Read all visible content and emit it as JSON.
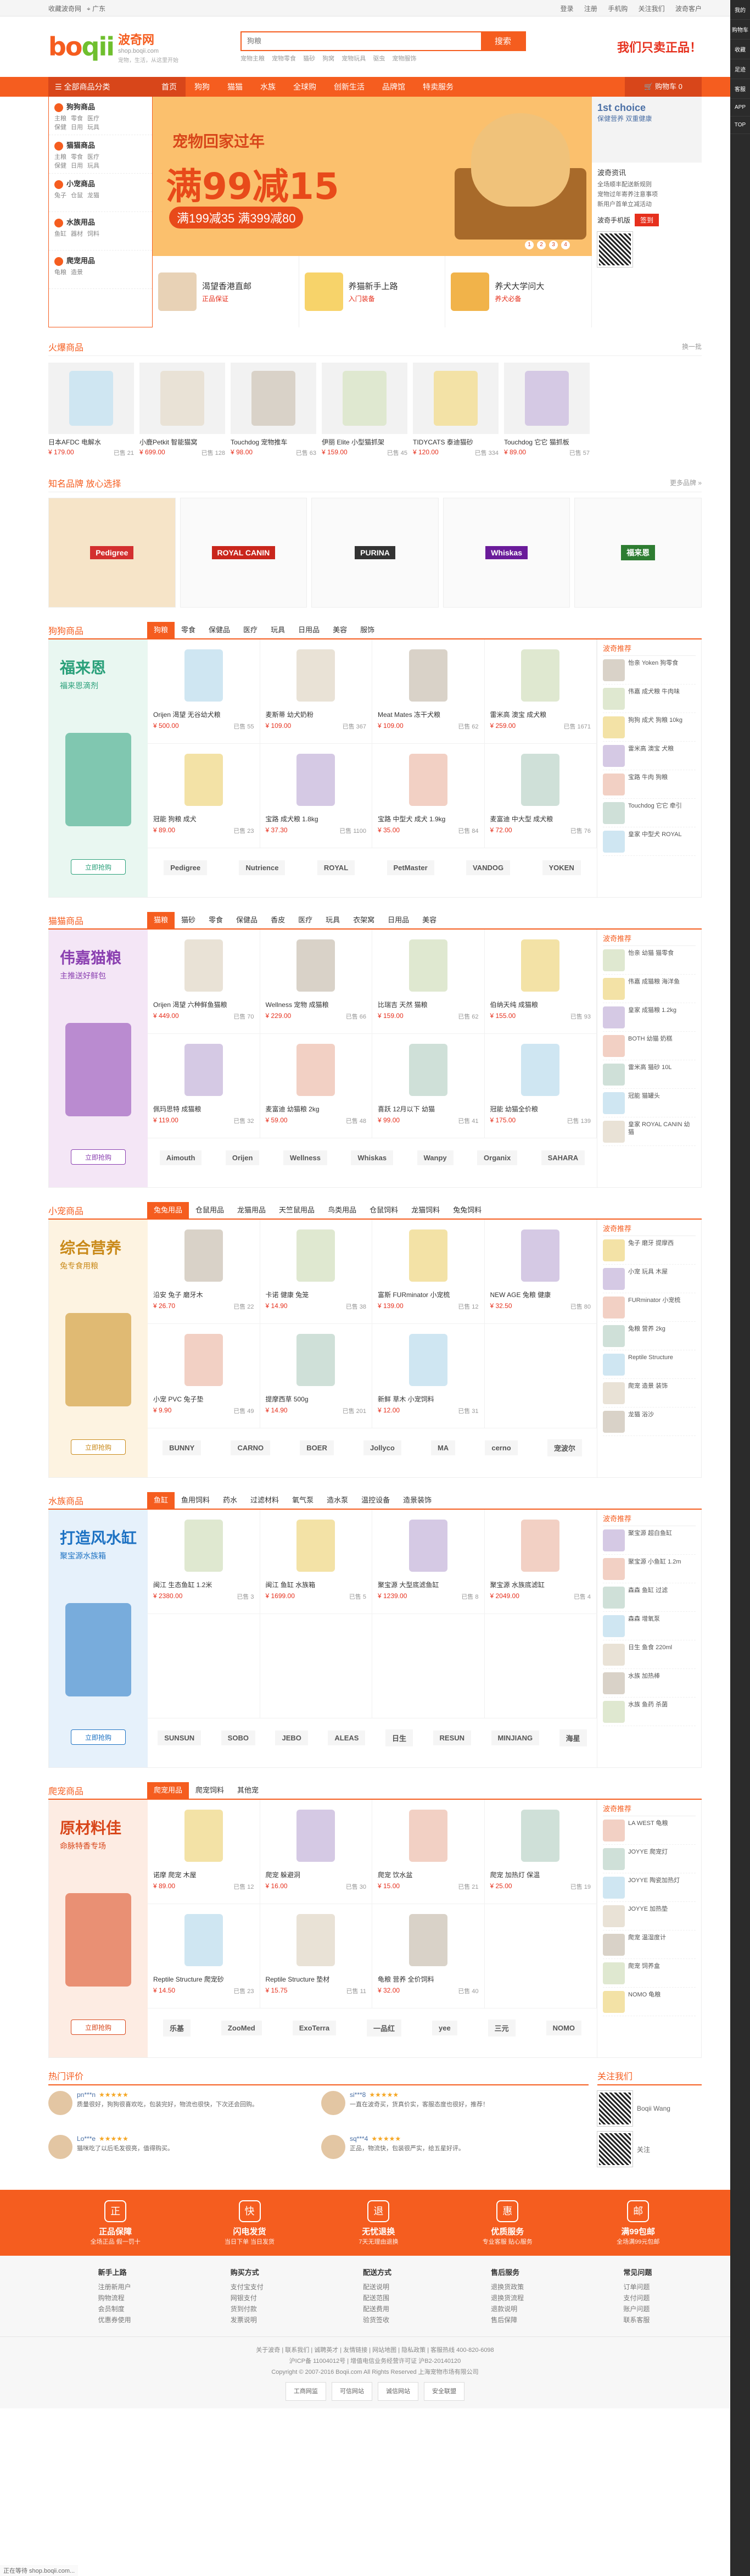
{
  "topbar": {
    "left": [
      "收藏波奇网",
      "广东"
    ],
    "links": [
      "登录",
      "注册",
      "手机购",
      "关注我们",
      "波奇客户"
    ]
  },
  "header": {
    "logo_text": "boqii",
    "logo_cn": "波奇网",
    "logo_en": "shop.boqii.com",
    "slogan": "宠物，生活，从这里开始",
    "search_placeholder": "狗粮",
    "search_button": "搜索",
    "hotwords": [
      "宠物主粮",
      "宠物零食",
      "猫砂",
      "狗窝",
      "宠物玩具",
      "驱虫",
      "宠物服饰"
    ],
    "right_text": "我们只卖正品！"
  },
  "nav": {
    "category_label": "全部商品分类",
    "items": [
      "首页",
      "狗狗",
      "猫猫",
      "水族",
      "全球购",
      "创新生活",
      "品牌馆",
      "特卖服务"
    ],
    "cart_label": "购物车",
    "cart_count": "0"
  },
  "sidebar": [
    {
      "title": "狗狗商品",
      "subs": [
        "主粮",
        "零食",
        "医疗",
        "保健",
        "日用",
        "玩具"
      ]
    },
    {
      "title": "猫猫商品",
      "subs": [
        "主粮",
        "零食",
        "医疗",
        "保健",
        "日用",
        "玩具"
      ]
    },
    {
      "title": "小宠商品",
      "subs": [
        "兔子",
        "仓鼠",
        "龙猫"
      ]
    },
    {
      "title": "水族用品",
      "subs": [
        "鱼缸",
        "器材",
        "饲料"
      ]
    },
    {
      "title": "爬宠用品",
      "subs": [
        "龟粮",
        "造景"
      ]
    }
  ],
  "banner": {
    "title": "宠物回家过年",
    "big": "满99减15",
    "sub": "满199减35 满399减80",
    "dots": [
      "1",
      "2",
      "3",
      "4"
    ]
  },
  "hero_right": {
    "ad_title": "1st choice",
    "ad_sub": "保健营养 双重健康",
    "news_head": "波奇资讯",
    "news": [
      "全场顺丰配送新规则",
      "宠物过年寄养注意事项",
      "新用户首单立减活动"
    ],
    "signin": "签到",
    "app_text": "波奇手机版"
  },
  "promos": [
    {
      "title": "渴望香港直邮",
      "sub": "正品保证"
    },
    {
      "title": "养猫新手上路",
      "sub": "入门装备"
    },
    {
      "title": "养犬大学问大",
      "sub": "养犬必备"
    }
  ],
  "hot": {
    "title": "火爆商品",
    "more": "换一批",
    "items": [
      {
        "name": "日本AFDC 电解水",
        "price": "¥ 179.00",
        "sold": "已售 21"
      },
      {
        "name": "小鹿Petkit 智能猫窝",
        "price": "¥ 699.00",
        "sold": "已售 128"
      },
      {
        "name": "Touchdog 宠物推车",
        "price": "¥ 98.00",
        "sold": "已售 63"
      },
      {
        "name": "伊丽 Elite 小型猫抓架",
        "price": "¥ 159.00",
        "sold": "已售 45"
      },
      {
        "name": "TIDYCATS 泰迪猫砂",
        "price": "¥ 120.00",
        "sold": "已售 334"
      },
      {
        "name": "Touchdog 它它 猫抓板",
        "price": "¥ 89.00",
        "sold": "已售 57"
      }
    ]
  },
  "brands": {
    "title": "知名品牌 放心选择",
    "more": "更多品牌 »",
    "logos": [
      "Pedigree",
      "ROYAL CANIN",
      "PURINA",
      "Whiskas",
      "福来恩"
    ]
  },
  "floors": [
    {
      "title": "狗狗商品",
      "tabs": [
        "狗粮",
        "零食",
        "保健品",
        "医疗",
        "玩具",
        "日用品",
        "美容",
        "服饰"
      ],
      "ad_title": "福来恩",
      "ad_sub": "福来恩滴剂",
      "ad_btn": "立即抢购",
      "ad_color": "#2aa07a",
      "ad_bg": "#e9f7f1",
      "products": [
        {
          "name": "Orijen 渴望 无谷幼犬粮",
          "price": "¥ 500.00",
          "sold": "已售 55"
        },
        {
          "name": "麦斯蒂 幼犬奶粉",
          "price": "¥ 109.00",
          "sold": "已售 367"
        },
        {
          "name": "Meat Mates 冻干犬粮",
          "price": "¥ 109.00",
          "sold": "已售 62"
        },
        {
          "name": "雷米高 澳宝 成犬粮",
          "price": "¥ 259.00",
          "sold": "已售 1671"
        },
        {
          "name": "冠能 狗粮 成犬",
          "price": "¥ 89.00",
          "sold": "已售 23"
        },
        {
          "name": "宝路 成犬粮 1.8kg",
          "price": "¥ 37.30",
          "sold": "已售 1100"
        },
        {
          "name": "宝路 中型犬 成犬 1.9kg",
          "price": "¥ 35.00",
          "sold": "已售 84"
        },
        {
          "name": "麦富迪 中大型 成犬粮",
          "price": "¥ 72.00",
          "sold": "已售 76"
        }
      ],
      "brands": [
        "Pedigree",
        "Nutrience",
        "ROYAL",
        "PetMaster",
        "VANDOG",
        "YOKEN"
      ],
      "rec_title": "波奇推荐",
      "rec": [
        "怡亲 Yoken 狗零食",
        "伟嘉 成犬粮 牛肉味",
        "狗狗 成犬 狗粮 10kg",
        "雷米高 澳宝 犬粮",
        "宝路 牛肉 狗粮",
        "Touchdog 它它 牵引",
        "皇家 中型犬 ROYAL"
      ]
    },
    {
      "title": "猫猫商品",
      "tabs": [
        "猫粮",
        "猫砂",
        "零食",
        "保健品",
        "香皮",
        "医疗",
        "玩具",
        "衣架窝",
        "日用品",
        "美容"
      ],
      "ad_title": "伟嘉猫粮",
      "ad_sub": "主推送好鲜包",
      "ad_btn": "立即抢购",
      "ad_color": "#8a3fb0",
      "ad_bg": "#f4e6f6",
      "products": [
        {
          "name": "Orijen 渴望 六种鲜鱼猫粮",
          "price": "¥ 449.00",
          "sold": "已售 70"
        },
        {
          "name": "Wellness 宠物 成猫粮",
          "price": "¥ 229.00",
          "sold": "已售 66"
        },
        {
          "name": "比瑞吉 天然 猫粮",
          "price": "¥ 159.00",
          "sold": "已售 62"
        },
        {
          "name": "伯纳天纯 成猫粮",
          "price": "¥ 155.00",
          "sold": "已售 93"
        },
        {
          "name": "佩玛思特 成猫粮",
          "price": "¥ 119.00",
          "sold": "已售 32"
        },
        {
          "name": "麦富迪 幼猫粮 2kg",
          "price": "¥ 59.00",
          "sold": "已售 48"
        },
        {
          "name": "喜跃 12月以下 幼猫",
          "price": "¥ 99.00",
          "sold": "已售 41"
        },
        {
          "name": "冠能 幼猫全价粮",
          "price": "¥ 175.00",
          "sold": "已售 139"
        }
      ],
      "brands": [
        "Aimouth",
        "Orijen",
        "Wellness",
        "Whiskas",
        "Wanpy",
        "Organix",
        "SAHARA"
      ],
      "rec_title": "波奇推荐",
      "rec": [
        "怡亲 幼猫 猫零食",
        "伟嘉 成猫粮 海洋鱼",
        "皇家 成猫粮 1.2kg",
        "BOTH 幼猫 奶糕",
        "雷米高 猫砂 10L",
        "冠能 猫罐头",
        "皇家 ROYAL CANIN 幼猫"
      ]
    },
    {
      "title": "小宠商品",
      "tabs": [
        "兔兔用品",
        "仓鼠用品",
        "龙猫用品",
        "天竺鼠用品",
        "鸟类用品",
        "仓鼠饲料",
        "龙猫饲料",
        "兔兔饲料"
      ],
      "ad_title": "综合营养",
      "ad_sub": "兔专食用粮",
      "ad_btn": "立即抢购",
      "ad_color": "#c98a1a",
      "ad_bg": "#fdf3e1",
      "products": [
        {
          "name": "沿安 兔子 磨牙木",
          "price": "¥ 26.70",
          "sold": "已售 22"
        },
        {
          "name": "卡诺 健康 兔笼",
          "price": "¥ 14.90",
          "sold": "已售 38"
        },
        {
          "name": "富斯 FURminator 小宠梳",
          "price": "¥ 139.00",
          "sold": "已售 12"
        },
        {
          "name": "NEW AGE 兔粮 健康",
          "price": "¥ 32.50",
          "sold": "已售 80"
        },
        {
          "name": "小宠 PVC 兔子垫",
          "price": "¥ 9.90",
          "sold": "已售 49"
        },
        {
          "name": "提摩西草 500g",
          "price": "¥ 14.90",
          "sold": "已售 201"
        },
        {
          "name": "新鲜 草木 小宠饲料",
          "price": "¥ 12.00",
          "sold": "已售 31"
        },
        {
          "name": "",
          "price": "",
          "sold": ""
        }
      ],
      "brands": [
        "BUNNY",
        "CARNO",
        "BOER",
        "Jollyco",
        "MA",
        "cerno",
        "宠波尔"
      ],
      "rec_title": "波奇推荐",
      "rec": [
        "兔子 磨牙 提摩西",
        "小宠 玩具 木屋",
        "FURminator 小宠梳",
        "兔粮 营养 2kg",
        "Reptile Structure",
        "爬宠 造景 装饰",
        "龙猫 浴沙"
      ]
    },
    {
      "title": "水族商品",
      "tabs": [
        "鱼缸",
        "鱼用饲料",
        "药水",
        "过滤材料",
        "氧气泵",
        "造水泵",
        "温控设备",
        "造景装饰"
      ],
      "ad_title": "打造风水缸",
      "ad_sub": "聚宝源水族箱",
      "ad_btn": "立即抢购",
      "ad_color": "#1d72c3",
      "ad_bg": "#e6f1fb",
      "products": [
        {
          "name": "闽江 生态鱼缸 1.2米",
          "price": "¥ 2380.00",
          "sold": "已售 3"
        },
        {
          "name": "闽江 鱼缸 水族箱",
          "price": "¥ 1699.00",
          "sold": "已售 5"
        },
        {
          "name": "聚宝源 大型底滤鱼缸",
          "price": "¥ 1239.00",
          "sold": "已售 8"
        },
        {
          "name": "聚宝源 水族底滤缸",
          "price": "¥ 2049.00",
          "sold": "已售 4"
        },
        {
          "name": "",
          "price": "",
          "sold": ""
        },
        {
          "name": "",
          "price": "",
          "sold": ""
        },
        {
          "name": "",
          "price": "",
          "sold": ""
        },
        {
          "name": "",
          "price": "",
          "sold": ""
        }
      ],
      "brands": [
        "SUNSUN",
        "SOBO",
        "JEBO",
        "ALEAS",
        "日生",
        "RESUN",
        "MINJIANG",
        "海星"
      ],
      "rec_title": "波奇推荐",
      "rec": [
        "聚宝源 超白鱼缸",
        "聚宝源 小鱼缸 1.2m",
        "森森 鱼缸 过滤",
        "森森 增氧泵",
        "日生 鱼食 220ml",
        "水族 加热棒",
        "水族 鱼药 杀菌"
      ]
    },
    {
      "title": "爬宠商品",
      "tabs": [
        "爬宠用品",
        "爬宠饲料",
        "其他宠"
      ],
      "ad_title": "原材料佳",
      "ad_sub": "命脉特香专场",
      "ad_btn": "立即抢购",
      "ad_color": "#d8461a",
      "ad_bg": "#fdece3",
      "products": [
        {
          "name": "诺摩 爬宠 木屋",
          "price": "¥ 89.00",
          "sold": "已售 12"
        },
        {
          "name": "爬宠 躲避洞",
          "price": "¥ 16.00",
          "sold": "已售 30"
        },
        {
          "name": "爬宠 饮水盆",
          "price": "¥ 15.00",
          "sold": "已售 21"
        },
        {
          "name": "爬宠 加热灯 保温",
          "price": "¥ 25.00",
          "sold": "已售 19"
        },
        {
          "name": "Reptile Structure 爬宠砂",
          "price": "¥ 14.50",
          "sold": "已售 23"
        },
        {
          "name": "Reptile Structure 垫材",
          "price": "¥ 15.75",
          "sold": "已售 11"
        },
        {
          "name": "龟粮 营养 全价饲料",
          "price": "¥ 32.00",
          "sold": "已售 40"
        },
        {
          "name": "",
          "price": "",
          "sold": ""
        }
      ],
      "brands": [
        "乐基",
        "ZooMed",
        "ExoTerra",
        "一品红",
        "yee",
        "三元",
        "NOMO"
      ],
      "rec_title": "波奇推荐",
      "rec": [
        "LA WEST 龟粮",
        "JOYYE 爬宠灯",
        "JOYYE 陶瓷加热灯",
        "JOYYE 加热垫",
        "爬宠 温湿度计",
        "爬宠 饲养盒",
        "NOMO 龟粮"
      ]
    }
  ],
  "reviews": {
    "title": "热门评价",
    "items": [
      {
        "user": "pn***n",
        "stars": "★★★★★",
        "content": "质量很好，狗狗很喜欢吃，包装完好，物流也很快，下次还会回购。"
      },
      {
        "user": "si***8",
        "stars": "★★★★★",
        "content": "一直在波奇买，货真价实，客服态度也很好，推荐！"
      },
      {
        "user": "Lo***e",
        "stars": "★★★★★",
        "content": "猫咪吃了以后毛发很亮，值得购买。"
      },
      {
        "user": "sq***4",
        "stars": "★★★★★",
        "content": "正品，物流快，包装很严实，给五星好评。"
      }
    ]
  },
  "follow": {
    "title": "关注我们",
    "qr1": "Boqii Wang",
    "qr2": "关注"
  },
  "services": [
    {
      "icon": "正",
      "title": "正品保障",
      "sub": "全场正品 假一罚十"
    },
    {
      "icon": "快",
      "title": "闪电发货",
      "sub": "当日下单 当日发货"
    },
    {
      "icon": "退",
      "title": "无忧退换",
      "sub": "7天无理由退换"
    },
    {
      "icon": "惠",
      "title": "优质服务",
      "sub": "专业客服 贴心服务"
    },
    {
      "icon": "邮",
      "title": "满99包邮",
      "sub": "全场满99元包邮"
    }
  ],
  "footer_cols": [
    {
      "head": "新手上路",
      "links": [
        "注册新用户",
        "购物流程",
        "会员制度",
        "优惠券使用"
      ]
    },
    {
      "head": "购买方式",
      "links": [
        "支付宝支付",
        "网银支付",
        "货到付款",
        "发票说明"
      ]
    },
    {
      "head": "配送方式",
      "links": [
        "配送说明",
        "配送范围",
        "配送费用",
        "验货签收"
      ]
    },
    {
      "head": "售后服务",
      "links": [
        "退换货政策",
        "退换货流程",
        "退款说明",
        "售后保障"
      ]
    },
    {
      "head": "常见问题",
      "links": [
        "订单问题",
        "支付问题",
        "账户问题",
        "联系客服"
      ]
    }
  ],
  "copyright": {
    "line1": "关于波奇 | 联系我们 | 诚聘英才 | 友情链接 | 网站地图 | 隐私政策 | 客服热线 400-820-6098",
    "line2": "沪ICP备 11004012号 | 增值电信业务经营许可证 沪B2-20140120",
    "line3": "Copyright © 2007-2016 Boqii.com All Rights Reserved 上海宠物市场有限公司",
    "badges": [
      "工商网监",
      "可信网站",
      "诚信网站",
      "安全联盟"
    ]
  },
  "rail": [
    "我的",
    "购物车",
    "收藏",
    "足迹",
    "客服",
    "APP",
    "TOP"
  ],
  "statusbar": "正在等待 shop.boqii.com..."
}
